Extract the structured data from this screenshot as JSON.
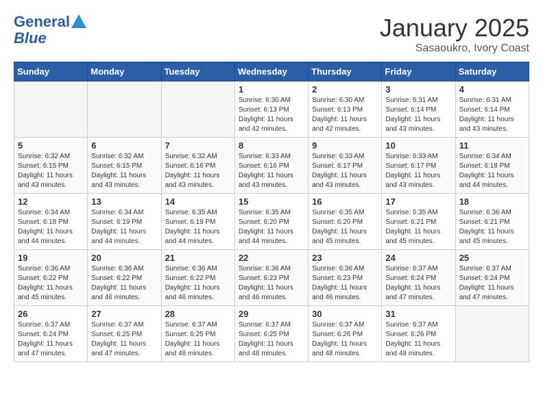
{
  "header": {
    "logo_line1": "General",
    "logo_line2": "Blue",
    "title": "January 2025",
    "subtitle": "Sasaoukro, Ivory Coast"
  },
  "days_of_week": [
    "Sunday",
    "Monday",
    "Tuesday",
    "Wednesday",
    "Thursday",
    "Friday",
    "Saturday"
  ],
  "weeks": [
    [
      {
        "day": "",
        "info": ""
      },
      {
        "day": "",
        "info": ""
      },
      {
        "day": "",
        "info": ""
      },
      {
        "day": "1",
        "info": "Sunrise: 6:30 AM\nSunset: 6:13 PM\nDaylight: 11 hours\nand 42 minutes."
      },
      {
        "day": "2",
        "info": "Sunrise: 6:30 AM\nSunset: 6:13 PM\nDaylight: 11 hours\nand 42 minutes."
      },
      {
        "day": "3",
        "info": "Sunrise: 6:31 AM\nSunset: 6:14 PM\nDaylight: 11 hours\nand 43 minutes."
      },
      {
        "day": "4",
        "info": "Sunrise: 6:31 AM\nSunset: 6:14 PM\nDaylight: 11 hours\nand 43 minutes."
      }
    ],
    [
      {
        "day": "5",
        "info": "Sunrise: 6:32 AM\nSunset: 6:15 PM\nDaylight: 11 hours\nand 43 minutes."
      },
      {
        "day": "6",
        "info": "Sunrise: 6:32 AM\nSunset: 6:15 PM\nDaylight: 11 hours\nand 43 minutes."
      },
      {
        "day": "7",
        "info": "Sunrise: 6:32 AM\nSunset: 6:16 PM\nDaylight: 11 hours\nand 43 minutes."
      },
      {
        "day": "8",
        "info": "Sunrise: 6:33 AM\nSunset: 6:16 PM\nDaylight: 11 hours\nand 43 minutes."
      },
      {
        "day": "9",
        "info": "Sunrise: 6:33 AM\nSunset: 6:17 PM\nDaylight: 11 hours\nand 43 minutes."
      },
      {
        "day": "10",
        "info": "Sunrise: 6:33 AM\nSunset: 6:17 PM\nDaylight: 11 hours\nand 43 minutes."
      },
      {
        "day": "11",
        "info": "Sunrise: 6:34 AM\nSunset: 6:18 PM\nDaylight: 11 hours\nand 44 minutes."
      }
    ],
    [
      {
        "day": "12",
        "info": "Sunrise: 6:34 AM\nSunset: 6:18 PM\nDaylight: 11 hours\nand 44 minutes."
      },
      {
        "day": "13",
        "info": "Sunrise: 6:34 AM\nSunset: 6:19 PM\nDaylight: 11 hours\nand 44 minutes."
      },
      {
        "day": "14",
        "info": "Sunrise: 6:35 AM\nSunset: 6:19 PM\nDaylight: 11 hours\nand 44 minutes."
      },
      {
        "day": "15",
        "info": "Sunrise: 6:35 AM\nSunset: 6:20 PM\nDaylight: 11 hours\nand 44 minutes."
      },
      {
        "day": "16",
        "info": "Sunrise: 6:35 AM\nSunset: 6:20 PM\nDaylight: 11 hours\nand 45 minutes."
      },
      {
        "day": "17",
        "info": "Sunrise: 6:35 AM\nSunset: 6:21 PM\nDaylight: 11 hours\nand 45 minutes."
      },
      {
        "day": "18",
        "info": "Sunrise: 6:36 AM\nSunset: 6:21 PM\nDaylight: 11 hours\nand 45 minutes."
      }
    ],
    [
      {
        "day": "19",
        "info": "Sunrise: 6:36 AM\nSunset: 6:22 PM\nDaylight: 11 hours\nand 45 minutes."
      },
      {
        "day": "20",
        "info": "Sunrise: 6:36 AM\nSunset: 6:22 PM\nDaylight: 11 hours\nand 46 minutes."
      },
      {
        "day": "21",
        "info": "Sunrise: 6:36 AM\nSunset: 6:22 PM\nDaylight: 11 hours\nand 46 minutes."
      },
      {
        "day": "22",
        "info": "Sunrise: 6:36 AM\nSunset: 6:23 PM\nDaylight: 11 hours\nand 46 minutes."
      },
      {
        "day": "23",
        "info": "Sunrise: 6:36 AM\nSunset: 6:23 PM\nDaylight: 11 hours\nand 46 minutes."
      },
      {
        "day": "24",
        "info": "Sunrise: 6:37 AM\nSunset: 6:24 PM\nDaylight: 11 hours\nand 47 minutes."
      },
      {
        "day": "25",
        "info": "Sunrise: 6:37 AM\nSunset: 6:24 PM\nDaylight: 11 hours\nand 47 minutes."
      }
    ],
    [
      {
        "day": "26",
        "info": "Sunrise: 6:37 AM\nSunset: 6:24 PM\nDaylight: 11 hours\nand 47 minutes."
      },
      {
        "day": "27",
        "info": "Sunrise: 6:37 AM\nSunset: 6:25 PM\nDaylight: 11 hours\nand 47 minutes."
      },
      {
        "day": "28",
        "info": "Sunrise: 6:37 AM\nSunset: 6:25 PM\nDaylight: 11 hours\nand 48 minutes."
      },
      {
        "day": "29",
        "info": "Sunrise: 6:37 AM\nSunset: 6:25 PM\nDaylight: 11 hours\nand 48 minutes."
      },
      {
        "day": "30",
        "info": "Sunrise: 6:37 AM\nSunset: 6:26 PM\nDaylight: 11 hours\nand 48 minutes."
      },
      {
        "day": "31",
        "info": "Sunrise: 6:37 AM\nSunset: 6:26 PM\nDaylight: 11 hours\nand 48 minutes."
      },
      {
        "day": "",
        "info": ""
      }
    ]
  ]
}
